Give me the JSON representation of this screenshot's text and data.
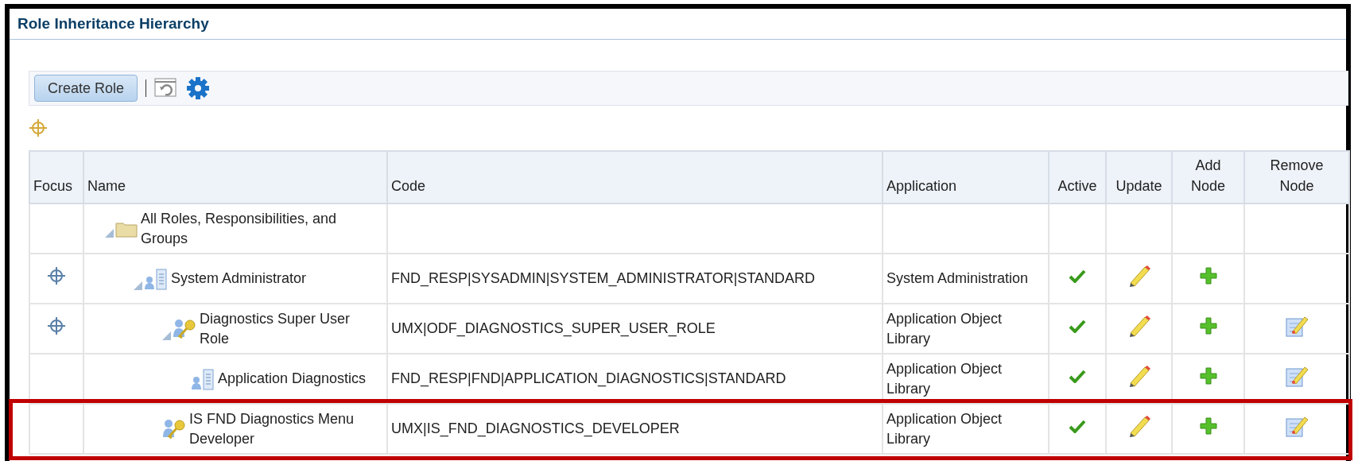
{
  "window": {
    "title": "Role Inheritance Hierarchy"
  },
  "toolbar": {
    "create_button": "Create Role"
  },
  "table": {
    "columns": [
      "Focus",
      "Name",
      "Code",
      "Application",
      "Active",
      "Update",
      "Add Node",
      "Remove Node"
    ],
    "rows": [
      {
        "name": "All Roles, Responsibilities, and Groups",
        "kind": "folder",
        "expanded": true,
        "focusable": false,
        "code": "",
        "application": "",
        "active": false,
        "can_update": false,
        "can_add": false,
        "can_remove": false,
        "highlighted": false,
        "children": [
          {
            "name": "System Administrator",
            "kind": "responsibility",
            "expanded": true,
            "focusable": true,
            "code": "FND_RESP|SYSADMIN|SYSTEM_ADMINISTRATOR|STANDARD",
            "application": "System Administration",
            "active": true,
            "can_update": true,
            "can_add": true,
            "can_remove": false,
            "highlighted": false,
            "children": [
              {
                "name": "Diagnostics Super User Role",
                "kind": "role",
                "expanded": true,
                "focusable": true,
                "code": "UMX|ODF_DIAGNOSTICS_SUPER_USER_ROLE",
                "application": "Application Object Library",
                "active": true,
                "can_update": true,
                "can_add": true,
                "can_remove": true,
                "highlighted": false,
                "children": [
                  {
                    "name": "Application Diagnostics",
                    "kind": "responsibility",
                    "expanded": false,
                    "focusable": false,
                    "code": "FND_RESP|FND|APPLICATION_DIAGNOSTICS|STANDARD",
                    "application": "Application Object Library",
                    "active": true,
                    "can_update": true,
                    "can_add": true,
                    "can_remove": true,
                    "highlighted": false
                  }
                ]
              },
              {
                "name": "IS FND Diagnostics Menu Developer",
                "kind": "role",
                "expanded": false,
                "focusable": false,
                "code": "UMX|IS_FND_DIAGNOSTICS_DEVELOPER",
                "application": "Application Object Library",
                "active": true,
                "can_update": true,
                "can_add": true,
                "can_remove": true,
                "highlighted": true
              }
            ]
          }
        ]
      }
    ]
  }
}
